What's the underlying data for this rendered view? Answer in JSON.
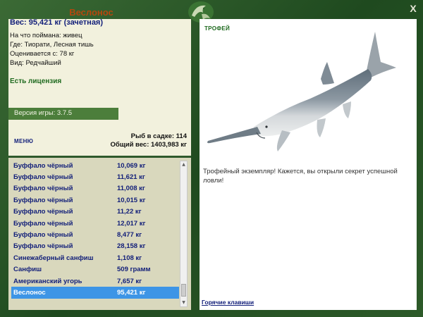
{
  "fish": {
    "name": "Веслонос",
    "weight_line": "Вес: 95,421 кг (зачетная)",
    "details": [
      "На что поймана: живец",
      "Где: Тиорати, Лесная тишь",
      "Оценивается с: 78 кг",
      "Вид: Редчайший"
    ]
  },
  "license": "Есть лицензия",
  "version": "Версия игры: 3.7.5",
  "menu_label": "МЕНЮ",
  "stats": {
    "count_line": "Рыб в садке: 114",
    "total_line": "Общий вес: 1403,983 кг"
  },
  "catch_list": [
    {
      "name": "Буффало чёрный",
      "weight": "10,069 кг"
    },
    {
      "name": "Буффало чёрный",
      "weight": "11,621 кг"
    },
    {
      "name": "Буффало чёрный",
      "weight": "11,008 кг"
    },
    {
      "name": "Буффало чёрный",
      "weight": "10,015 кг"
    },
    {
      "name": "Буффало чёрный",
      "weight": "11,22 кг"
    },
    {
      "name": "Буффало чёрный",
      "weight": "12,017 кг"
    },
    {
      "name": "Буффало чёрный",
      "weight": "8,477 кг"
    },
    {
      "name": "Буффало чёрный",
      "weight": "28,158 кг"
    },
    {
      "name": "Синежаберный санфиш",
      "weight": "1,108 кг"
    },
    {
      "name": "Санфиш",
      "weight": "509 грамм"
    },
    {
      "name": "Американский угорь",
      "weight": "7,657 кг"
    },
    {
      "name": "Веслонос",
      "weight": "95,421 кг"
    }
  ],
  "selected_index": 11,
  "trophy": {
    "label": "ТРОФЕЙ",
    "text": "Трофейный экземпляр! Кажется, вы открыли секрет успешной ловли!"
  },
  "hotkeys_label": "Горячие клавиши",
  "close_label": "X",
  "colors": {
    "frame": "#2f5a2c",
    "panel": "#f2f1dd",
    "list_bg": "#d9d8bd",
    "selection": "#3d95e6",
    "fish_name": "#b5470e",
    "text_blue": "#13207a"
  }
}
